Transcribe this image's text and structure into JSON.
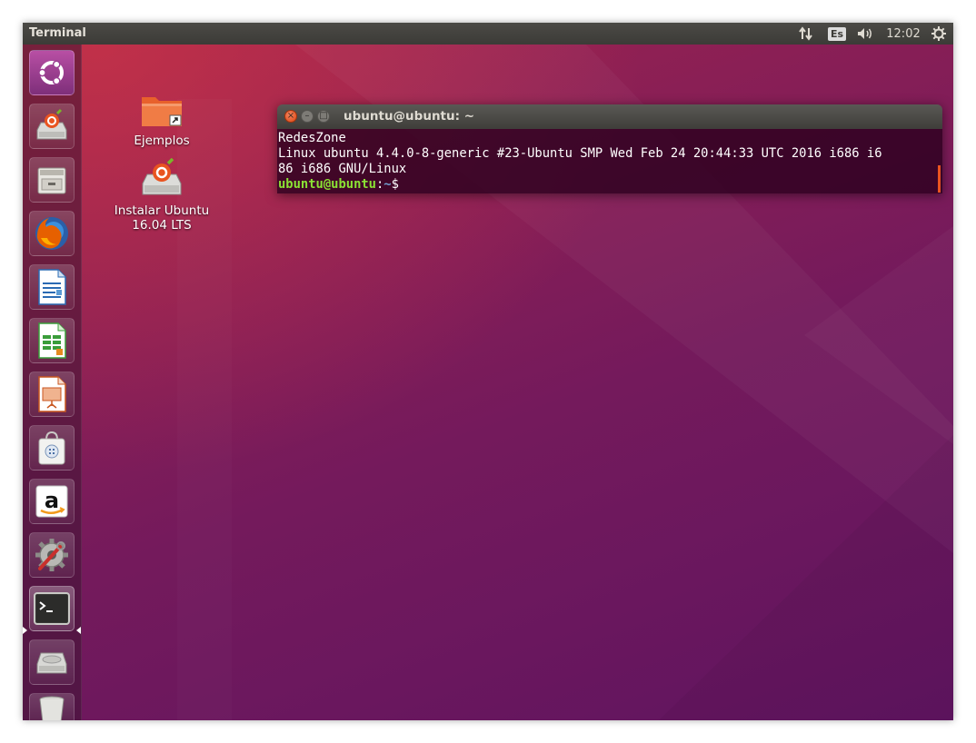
{
  "top_panel": {
    "title": "Terminal",
    "keyboard_layout": "Es",
    "clock": "12:02",
    "icons": [
      "network-transfer-icon",
      "keyboard-layout-indicator",
      "volume-icon",
      "session-gear-icon"
    ]
  },
  "launcher": {
    "items": [
      {
        "name": "dash-home",
        "icon": "ubuntu-logo-icon"
      },
      {
        "name": "install-ubuntu",
        "icon": "install-ubuntu-icon"
      },
      {
        "name": "files",
        "icon": "file-cabinet-icon"
      },
      {
        "name": "firefox",
        "icon": "firefox-icon"
      },
      {
        "name": "libreoffice-writer",
        "icon": "writer-icon"
      },
      {
        "name": "libreoffice-calc",
        "icon": "calc-icon"
      },
      {
        "name": "libreoffice-impress",
        "icon": "impress-icon"
      },
      {
        "name": "ubuntu-software",
        "icon": "shopping-bag-icon"
      },
      {
        "name": "amazon",
        "icon": "amazon-icon"
      },
      {
        "name": "system-settings",
        "icon": "settings-wrench-icon"
      },
      {
        "name": "terminal",
        "icon": "terminal-icon",
        "active": true
      },
      {
        "name": "drive",
        "icon": "hard-drive-icon"
      },
      {
        "name": "trash",
        "icon": "trash-icon"
      }
    ]
  },
  "desktop": {
    "icons": [
      {
        "label": "Ejemplos",
        "icon": "folder-link-icon"
      },
      {
        "label": "Instalar Ubuntu 16.04 LTS",
        "label_line1": "Instalar Ubuntu",
        "label_line2": "16.04 LTS",
        "icon": "install-ubuntu-icon"
      }
    ]
  },
  "terminal": {
    "title": "ubuntu@ubuntu: ~",
    "lines": [
      "RedesZone",
      "Linux ubuntu 4.4.0-8-generic #23-Ubuntu SMP Wed Feb 24 20:44:33 UTC 2016 i686 i6",
      "86 i686 GNU/Linux"
    ],
    "prompt_user": "ubuntu@ubuntu",
    "prompt_sep": ":",
    "prompt_path": "~",
    "prompt_symbol": "$"
  },
  "colors": {
    "accent": "#e95420",
    "panel": "#3c3b37",
    "desktop_top": "#a2234c",
    "desktop_bottom": "#5f1460",
    "prompt_user": "#8ae234",
    "prompt_path": "#729fcf"
  }
}
